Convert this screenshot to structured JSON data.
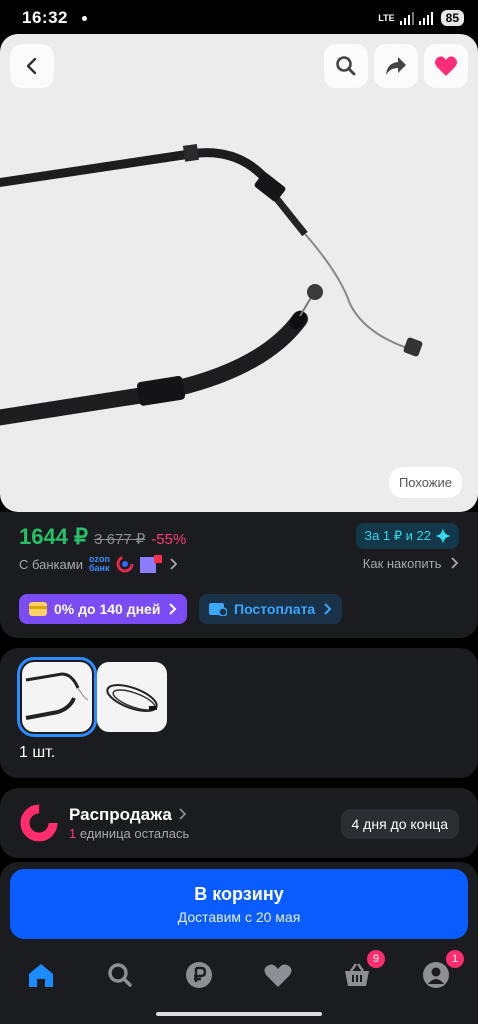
{
  "status": {
    "time": "16:32",
    "network": "LTE",
    "battery": "85"
  },
  "hero": {
    "similar_label": "Похожие"
  },
  "price": {
    "current": "1644 ₽",
    "old": "3 677 ₽",
    "discount": "-55%",
    "bonus": "За 1 ₽ и 22",
    "banks_label": "С банками",
    "ozon_bank_line1": "ozon",
    "ozon_bank_line2": "банк",
    "accumulate_label": "Как накопить",
    "installment_label": "0% до 140 дней",
    "postpay_label": "Постоплата"
  },
  "variants": {
    "quantity_label": "1 шт."
  },
  "sale": {
    "title": "Распродажа",
    "remaining_count": "1",
    "remaining_text": " единица осталась",
    "countdown": "4 дня до конца"
  },
  "cta": {
    "title": "В корзину",
    "subtitle": "Доставим с 20 мая"
  },
  "tabbar": {
    "cart_badge": "9",
    "profile_badge": "1"
  },
  "colors": {
    "price_green": "#26c066",
    "accent_blue": "#0a5cff",
    "discount_pink": "#ff3d6e"
  }
}
